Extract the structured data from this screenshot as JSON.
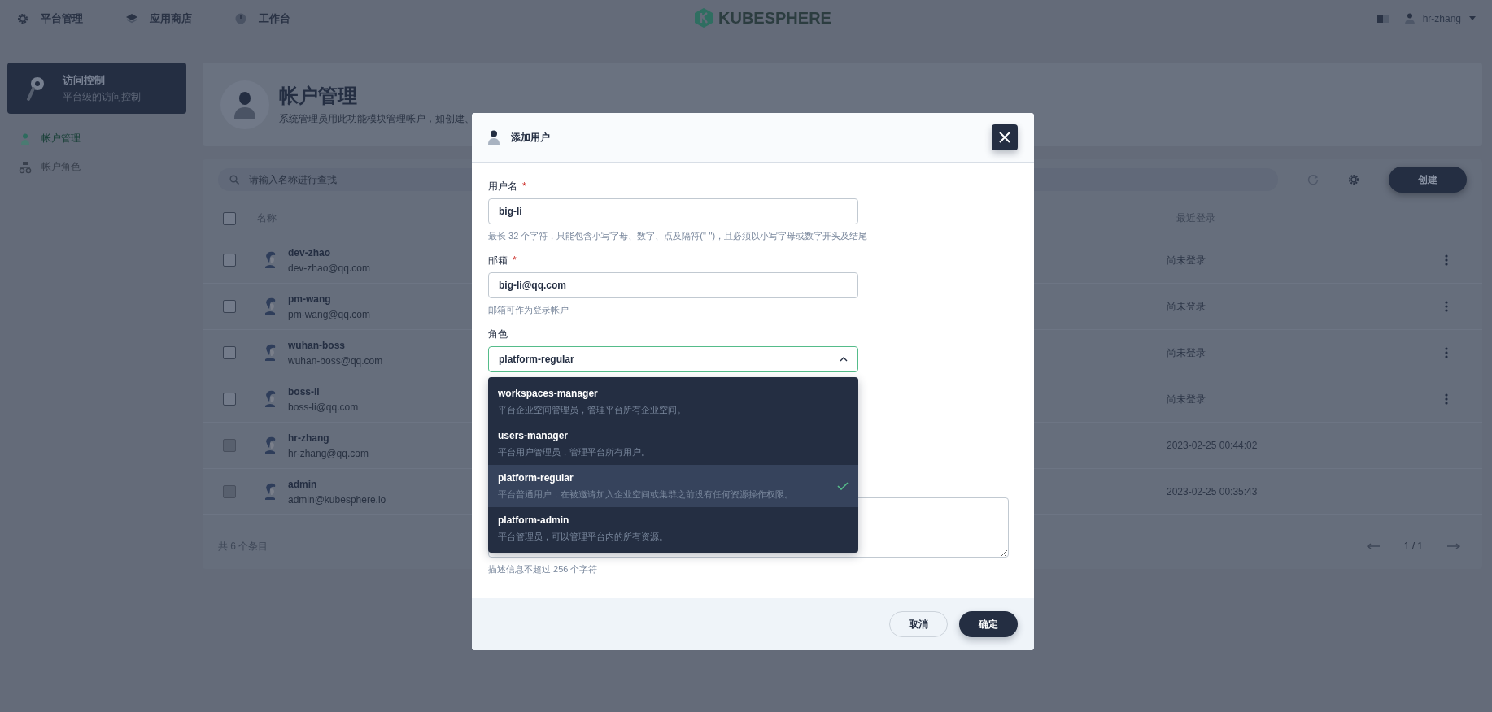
{
  "top_nav": {
    "items": [
      {
        "label": "平台管理",
        "kind": "gear"
      },
      {
        "label": "应用商店",
        "kind": "layers"
      },
      {
        "label": "工作台",
        "kind": "dial"
      }
    ],
    "logo": "KUBESPHERE",
    "user": "hr-zhang"
  },
  "sidebar": {
    "title": "访问控制",
    "subtitle": "平台级的访问控制",
    "items": [
      {
        "label": "帐户管理",
        "kind": "user",
        "selected": true
      },
      {
        "label": "帐户角色",
        "kind": "roles",
        "selected": false
      }
    ]
  },
  "header": {
    "title": "帐户管理",
    "description": "系统管理员用此功能模块管理帐户，如创建、"
  },
  "toolbar": {
    "search_placeholder": "请输入名称进行查找",
    "create_button": "创建"
  },
  "table": {
    "select_all_checked": false,
    "columns": [
      "名称",
      "最近登录"
    ],
    "rows": [
      {
        "name": "dev-zhao",
        "email": "dev-zhao@qq.com",
        "last_login": "尚未登录",
        "has_menu": true,
        "disabled": false
      },
      {
        "name": "pm-wang",
        "email": "pm-wang@qq.com",
        "last_login": "尚未登录",
        "has_menu": true,
        "disabled": false
      },
      {
        "name": "wuhan-boss",
        "email": "wuhan-boss@qq.com",
        "last_login": "尚未登录",
        "has_menu": true,
        "disabled": false
      },
      {
        "name": "boss-li",
        "email": "boss-li@qq.com",
        "last_login": "尚未登录",
        "has_menu": true,
        "disabled": false
      },
      {
        "name": "hr-zhang",
        "email": "hr-zhang@qq.com",
        "last_login": "2023-02-25 00:44:02",
        "has_menu": false,
        "disabled": true
      },
      {
        "name": "admin",
        "email": "admin@kubesphere.io",
        "last_login": "2023-02-25 00:35:43",
        "has_menu": false,
        "disabled": true
      }
    ]
  },
  "footer": {
    "total": "共 6 个条目",
    "page": "1 / 1"
  },
  "dialog": {
    "title": "添加用户",
    "fields": [
      {
        "kind": "text",
        "label": "用户名",
        "required_mark": "*",
        "value": "big-li",
        "hint": "最长 32 个字符，只能包含小写字母、数字、点及隔符(\"-\")，且必须以小写字母或数字开头及结尾"
      },
      {
        "kind": "text",
        "label": "邮箱",
        "required_mark": "*",
        "value": "big-li@qq.com",
        "hint": "邮箱可作为登录帐户"
      },
      {
        "kind": "select",
        "label": "角色",
        "value": "platform-regular",
        "expanded": true
      }
    ],
    "role_options": [
      {
        "name": "workspaces-manager",
        "description": "平台企业空间管理员，管理平台所有企业空间。",
        "selected": false
      },
      {
        "name": "users-manager",
        "description": "平台用户管理员，管理平台所有用户。",
        "selected": false
      },
      {
        "name": "platform-regular",
        "description": "平台普通用户，在被邀请加入企业空间或集群之前没有任何资源操作权限。",
        "selected": true
      },
      {
        "name": "platform-admin",
        "description": "平台管理员，可以管理平台内的所有资源。",
        "selected": false
      }
    ],
    "description_hint": "描述信息不超过 256 个字符",
    "buttons": [
      {
        "label": "取消",
        "kind": "secondary"
      },
      {
        "label": "确定",
        "kind": "primary"
      }
    ]
  }
}
